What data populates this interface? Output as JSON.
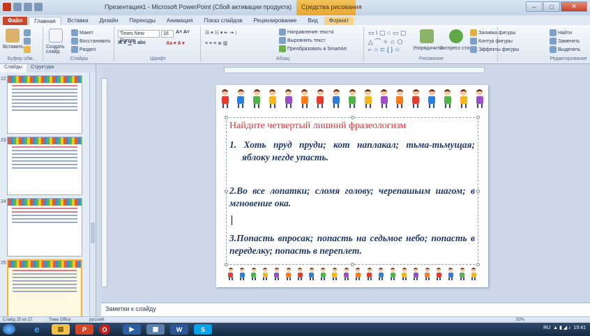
{
  "window": {
    "title": "Презентация1 - Microsoft PowerPoint (Сбой активации продукта)",
    "context_tab_group": "Средства рисования"
  },
  "tabs": [
    {
      "label": "Файл"
    },
    {
      "label": "Главная"
    },
    {
      "label": "Вставка"
    },
    {
      "label": "Дизайн"
    },
    {
      "label": "Переходы"
    },
    {
      "label": "Анимация"
    },
    {
      "label": "Показ слайдов"
    },
    {
      "label": "Рецензирование"
    },
    {
      "label": "Вид"
    },
    {
      "label": "Формат"
    }
  ],
  "ribbon": {
    "paste": "Вставить",
    "clipboard": "Буфер обм...",
    "new_slide": "Создать слайд",
    "layout": "Макет",
    "reset": "Восстановить",
    "section": "Раздел",
    "slides_group": "Слайды",
    "font_name": "Times New Roman",
    "font_size": "16",
    "font_group": "Шрифт",
    "text_direction": "Направление текста",
    "align_text": "Выровнять текст",
    "smartart": "Преобразовать в SmartArt",
    "paragraph_group": "Абзац",
    "arrange": "Упорядочить",
    "quick_styles": "Экспресс-стили",
    "shape_fill": "Заливка фигуры",
    "shape_outline": "Контур фигуры",
    "shape_effects": "Эффекты фигуры",
    "drawing_group": "Рисование",
    "find": "Найти",
    "replace": "Заменить",
    "select": "Выделить",
    "editing_group": "Редактирование"
  },
  "left_pane": {
    "tab_slides": "Слайды",
    "tab_outline": "Структура",
    "thumb_numbers": [
      "22",
      "23",
      "24",
      "25"
    ]
  },
  "slide": {
    "title": "Найдите четвертый лишний фразеологизм",
    "items": [
      "1. Хоть пруд пруди; кот наплакал; тьма-тьмущая; яблоку негде упасть.",
      "2.Во все лопатки; сломя голову; черепашьим шагом; в мгновение ока.",
      "3.Попасть впросак; попасть на седьмое небо; попасть в переделку; попасть в переплет."
    ]
  },
  "notes": {
    "placeholder": "Заметки к слайду"
  },
  "status": {
    "slide_info": "Слайд 25 из 27",
    "theme": "Тема Office",
    "language": "русский",
    "zoom": "50%"
  },
  "tray": {
    "lang": "RU",
    "time": "19:41",
    "date": "01.02.2015"
  }
}
